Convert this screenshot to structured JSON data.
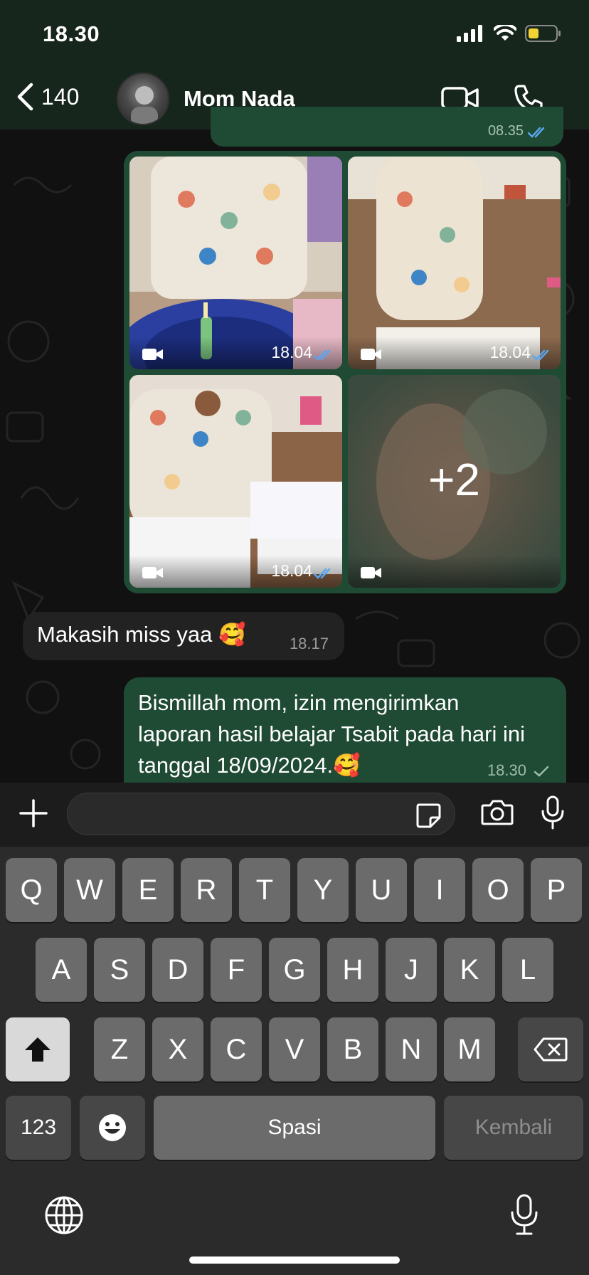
{
  "status_bar": {
    "time": "18.30"
  },
  "header": {
    "back_count": "140",
    "contact_name": "Mom Nada"
  },
  "previous_message": {
    "time": "08.35"
  },
  "media_grid": {
    "tiles": [
      {
        "kind": "video",
        "time": "18.04"
      },
      {
        "kind": "video",
        "time": "18.04"
      },
      {
        "kind": "video",
        "time": "18.04"
      },
      {
        "kind": "video",
        "more_label": "+2"
      }
    ]
  },
  "messages": [
    {
      "direction": "incoming",
      "text": "Makasih miss yaa 🥰",
      "time": "18.17"
    },
    {
      "direction": "outgoing",
      "text": "Bismillah mom, izin mengirimkan laporan hasil belajar Tsabit pada hari ini tanggal 18/09/2024.🥰",
      "time": "18.30",
      "status": "sent"
    }
  ],
  "input": {
    "placeholder": ""
  },
  "keyboard": {
    "row1": [
      "Q",
      "W",
      "E",
      "R",
      "T",
      "Y",
      "U",
      "I",
      "O",
      "P"
    ],
    "row2": [
      "A",
      "S",
      "D",
      "F",
      "G",
      "H",
      "J",
      "K",
      "L"
    ],
    "row3": [
      "Z",
      "X",
      "C",
      "V",
      "B",
      "N",
      "M"
    ],
    "numbers_label": "123",
    "space_label": "Spasi",
    "return_label": "Kembali"
  },
  "colors": {
    "outgoing_bubble": "#1f4a34",
    "incoming_bubble": "#222222",
    "read_tick": "#5aa7f0"
  }
}
